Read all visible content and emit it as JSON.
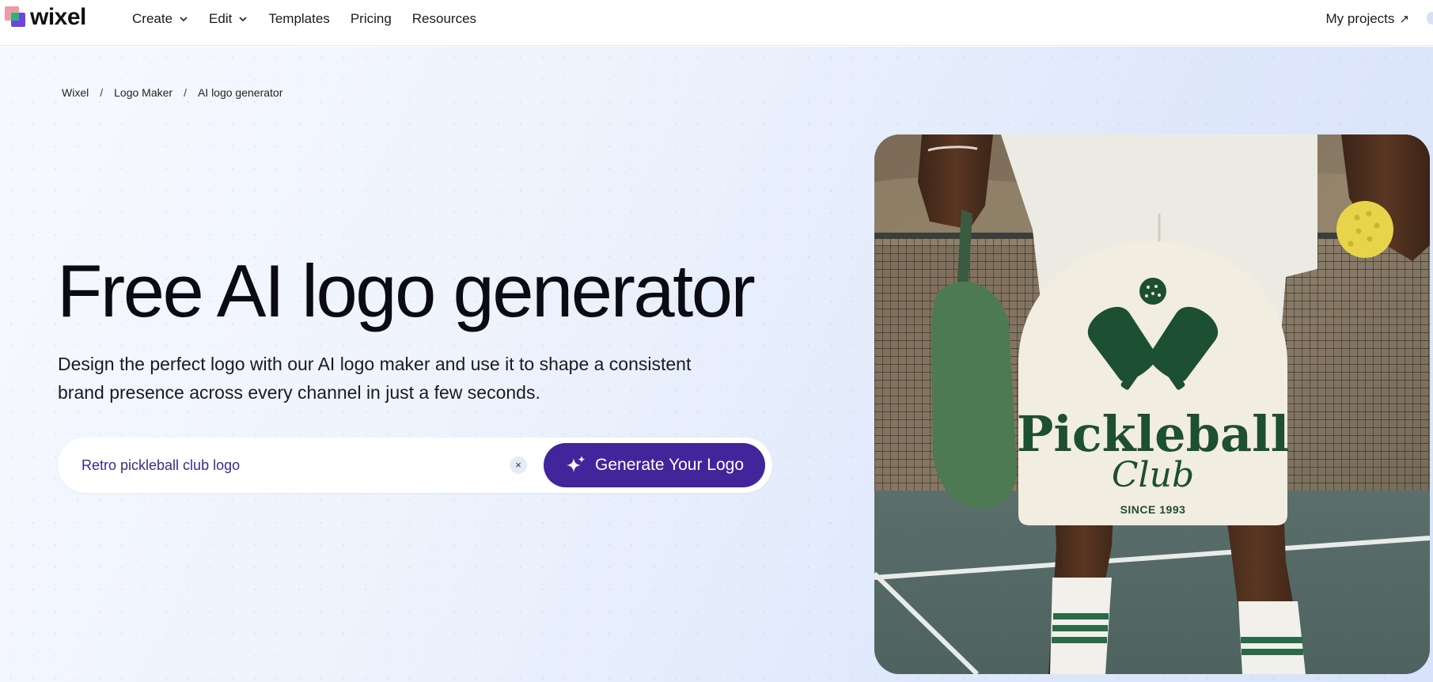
{
  "brand": {
    "name": "wixel"
  },
  "nav": {
    "items": [
      {
        "label": "Create",
        "dropdown": true
      },
      {
        "label": "Edit",
        "dropdown": true
      },
      {
        "label": "Templates",
        "dropdown": false
      },
      {
        "label": "Pricing",
        "dropdown": false
      },
      {
        "label": "Resources",
        "dropdown": false
      }
    ],
    "my_projects": "My projects",
    "external_arrow": "↗"
  },
  "breadcrumb": {
    "items": [
      "Wixel",
      "Logo Maker",
      "AI logo generator"
    ],
    "separator": "/"
  },
  "hero": {
    "title": "Free AI logo generator",
    "subtitle": "Design the perfect logo with our AI logo maker and use it to shape a consistent brand presence across every channel in just a few seconds.",
    "prompt_value": "Retro pickleball club logo",
    "clear_symbol": "×",
    "generate_label": "Generate Your Logo"
  },
  "showcase": {
    "logo_word": "Pickleball",
    "logo_script": "Club",
    "logo_since": "SINCE 1993"
  },
  "colors": {
    "accent": "#43259b",
    "prompt_text": "#3c2a8f",
    "logo_green": "#1d4f32",
    "badge_bg": "#f2ede1"
  },
  "icons": {
    "sparkle": "sparkle-icon",
    "chevron": "chevron-down-icon",
    "clear": "close-icon"
  }
}
